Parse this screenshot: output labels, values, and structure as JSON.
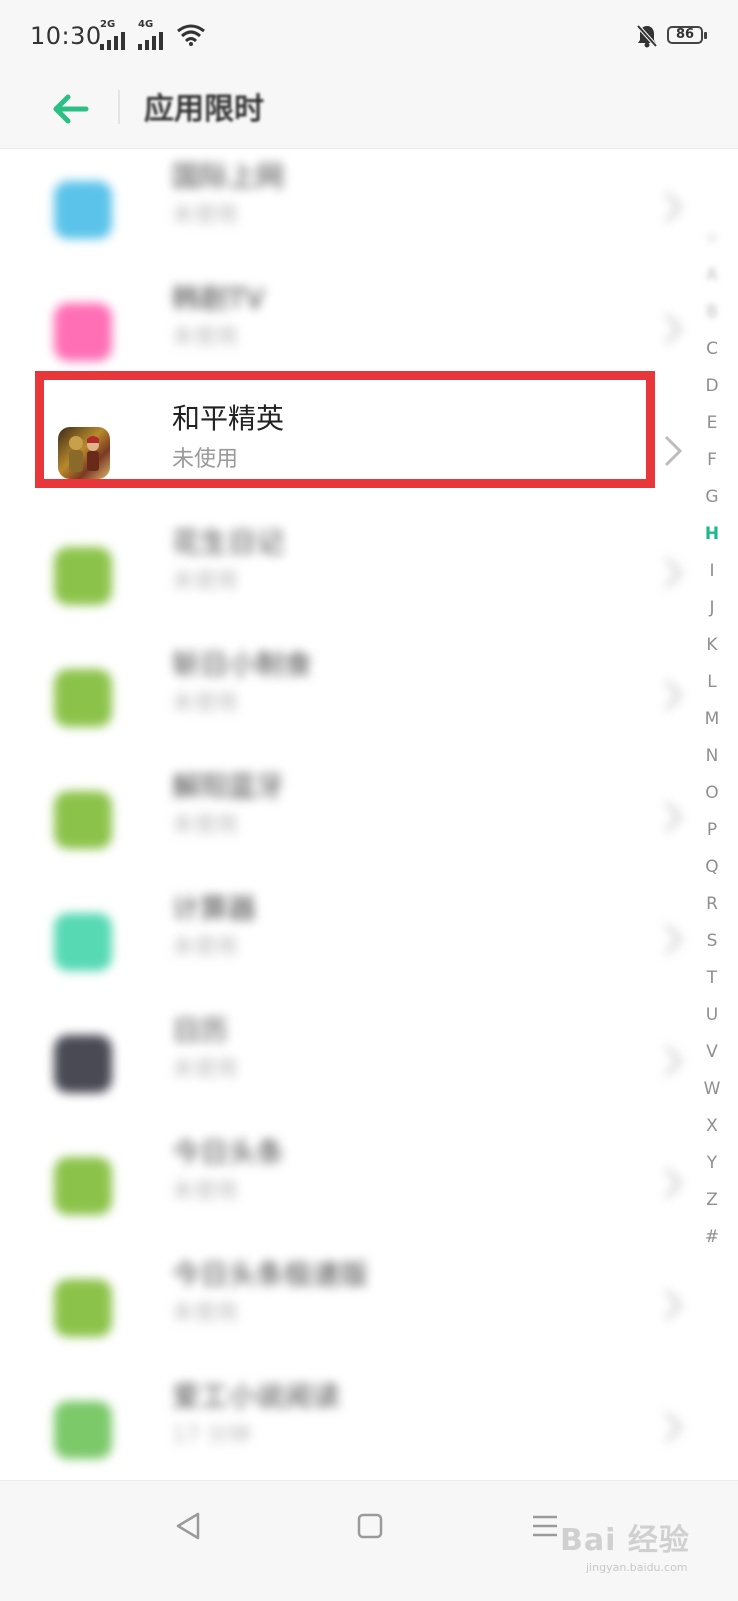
{
  "status_bar": {
    "time": "10:30",
    "signal_1_label": "2G",
    "signal_2_label": "4G",
    "battery_level": "86",
    "icons": [
      "signal-icon",
      "signal-icon",
      "wifi-icon",
      "silent-bell-icon",
      "battery-icon"
    ]
  },
  "header": {
    "back_icon": "arrow-left-icon",
    "title": "应用限时",
    "accent_color": "#2bbf86"
  },
  "apps": [
    {
      "name": "国际上网",
      "sub": "未使用",
      "icon_color": "#5bc3ea",
      "blurred": true
    },
    {
      "name": "韩剧TV",
      "sub": "未使用",
      "icon_color": "#ff6fb5",
      "blurred": true
    },
    {
      "name": "和平精英",
      "sub": "未使用",
      "icon_color": "#b88a2c",
      "blurred": false,
      "highlighted": true
    },
    {
      "name": "花生日记",
      "sub": "未使用",
      "icon_color": "#8bc34a",
      "blurred": true
    },
    {
      "name": "斩日小制食",
      "sub": "未使用",
      "icon_color": "#8bc34a",
      "blurred": true
    },
    {
      "name": "解阳蓝牙",
      "sub": "未使用",
      "icon_color": "#8bc34a",
      "blurred": true
    },
    {
      "name": "计算器",
      "sub": "未使用",
      "icon_color": "#57d9b4",
      "blurred": true
    },
    {
      "name": "日历",
      "sub": "未使用",
      "icon_color": "#4a4a55",
      "blurred": true
    },
    {
      "name": "今日头条",
      "sub": "未使用",
      "icon_color": "#8bc34a",
      "blurred": true
    },
    {
      "name": "今日头条极速版",
      "sub": "未使用",
      "icon_color": "#8bc34a",
      "blurred": true
    },
    {
      "name": "爱工小说阅读",
      "sub": "17 分钟",
      "icon_color": "#7cc96a",
      "blurred": true
    }
  ],
  "alphabet_index": {
    "letters": [
      "☆",
      "A",
      "B",
      "C",
      "D",
      "E",
      "F",
      "G",
      "H",
      "I",
      "J",
      "K",
      "L",
      "M",
      "N",
      "O",
      "P",
      "Q",
      "R",
      "S",
      "T",
      "U",
      "V",
      "W",
      "X",
      "Y",
      "Z",
      "#"
    ],
    "active": "H",
    "active_color": "#1fb88c"
  },
  "highlight_color": "#e8373b",
  "nav_bar": {
    "icons": [
      "back-triangle-icon",
      "home-square-icon",
      "recent-menu-icon"
    ],
    "watermark": "Bai 经验",
    "watermark_url": "jingyan.baidu.com"
  }
}
